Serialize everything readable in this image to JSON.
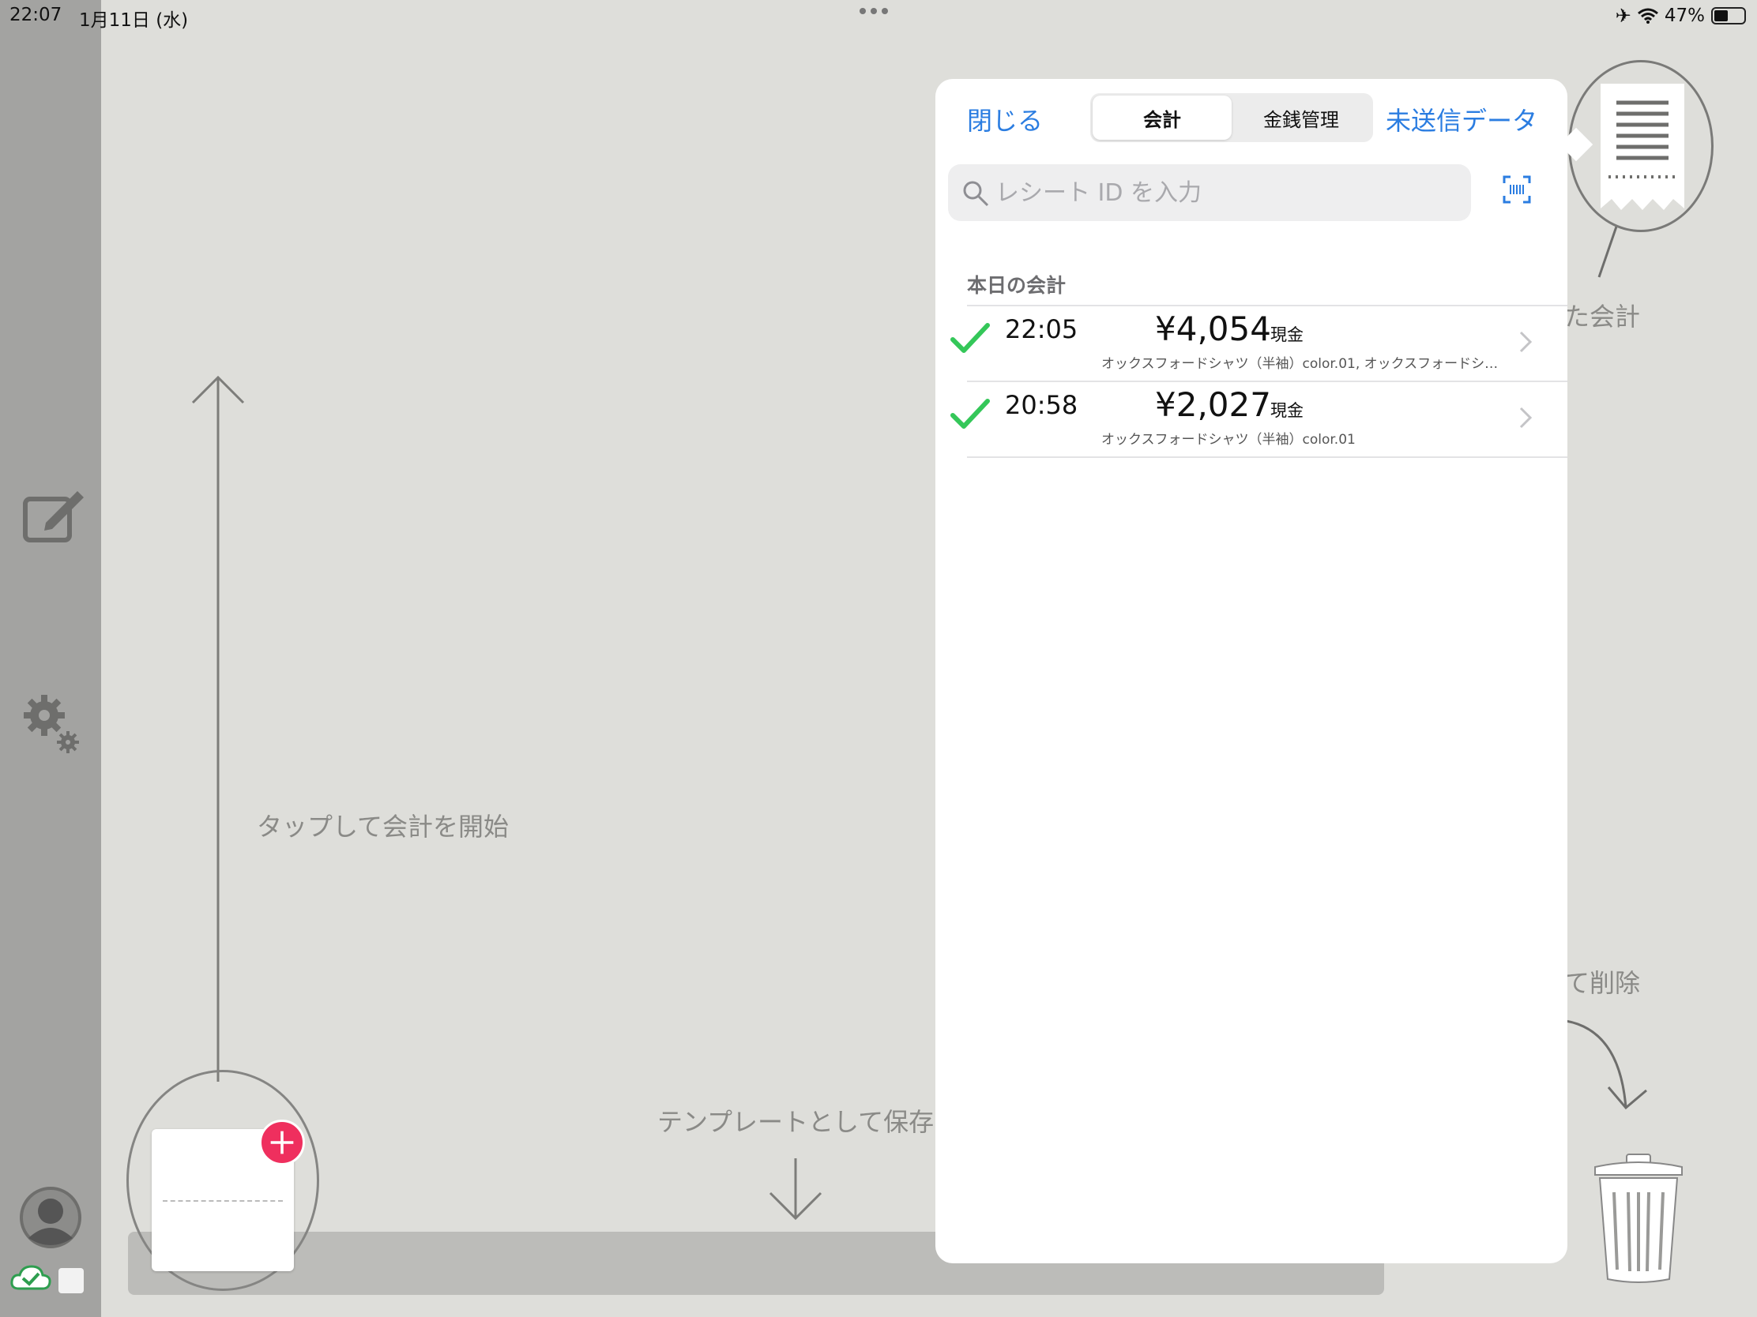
{
  "status_bar": {
    "time": "22:07",
    "date": "1月11日 (水)",
    "battery": "47%",
    "battery_level": 0.47
  },
  "hints": {
    "tap_to_start": "タップして会計を開始",
    "save_template": "テンプレートとして保存",
    "saved_checkout_partial": "た会計",
    "drag_delete_partial": "て削除"
  },
  "popover": {
    "close_label": "閉じる",
    "tabs": [
      {
        "label": "会計",
        "active": true
      },
      {
        "label": "金銭管理",
        "active": false
      }
    ],
    "unsent_label": "未送信データ",
    "search": {
      "placeholder": "レシート ID を入力"
    },
    "section_title": "本日の会計",
    "transactions": [
      {
        "time": "22:05",
        "amount": "¥4,054",
        "method": "現金",
        "items": "オックスフォードシャツ（半袖）color.01, オックスフォードシ…"
      },
      {
        "time": "20:58",
        "amount": "¥2,027",
        "method": "現金",
        "items": "オックスフォードシャツ（半袖）color.01"
      }
    ]
  },
  "colors": {
    "accent": "#2b7de1",
    "check": "#34c759",
    "badge": "#ef2f5e",
    "sync_cloud": "#2e9e4f"
  }
}
